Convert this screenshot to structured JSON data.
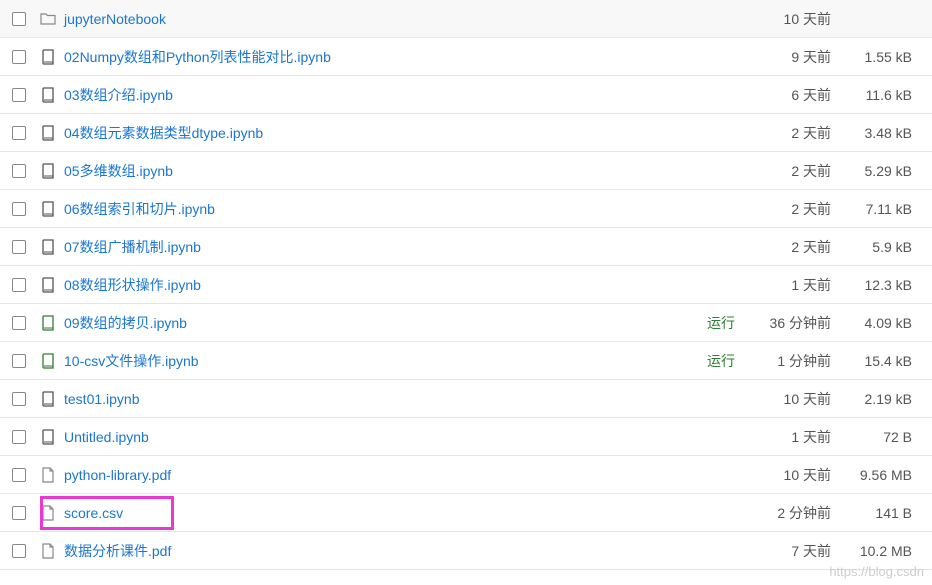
{
  "statusLabel": "运行",
  "watermark": "https://blog.csdn",
  "files": [
    {
      "name": "jupyterNotebook",
      "icon": "folder",
      "running": false,
      "modified": "10 天前",
      "size": "",
      "highlight": false
    },
    {
      "name": "02Numpy数组和Python列表性能对比.ipynb",
      "icon": "notebook",
      "running": false,
      "modified": "9 天前",
      "size": "1.55 kB",
      "highlight": false
    },
    {
      "name": "03数组介绍.ipynb",
      "icon": "notebook",
      "running": false,
      "modified": "6 天前",
      "size": "11.6 kB",
      "highlight": false
    },
    {
      "name": "04数组元素数据类型dtype.ipynb",
      "icon": "notebook",
      "running": false,
      "modified": "2 天前",
      "size": "3.48 kB",
      "highlight": false
    },
    {
      "name": "05多维数组.ipynb",
      "icon": "notebook",
      "running": false,
      "modified": "2 天前",
      "size": "5.29 kB",
      "highlight": false
    },
    {
      "name": "06数组索引和切片.ipynb",
      "icon": "notebook",
      "running": false,
      "modified": "2 天前",
      "size": "7.11 kB",
      "highlight": false
    },
    {
      "name": "07数组广播机制.ipynb",
      "icon": "notebook",
      "running": false,
      "modified": "2 天前",
      "size": "5.9 kB",
      "highlight": false
    },
    {
      "name": "08数组形状操作.ipynb",
      "icon": "notebook",
      "running": false,
      "modified": "1 天前",
      "size": "12.3 kB",
      "highlight": false
    },
    {
      "name": "09数组的拷贝.ipynb",
      "icon": "notebook-running",
      "running": true,
      "modified": "36 分钟前",
      "size": "4.09 kB",
      "highlight": false
    },
    {
      "name": "10-csv文件操作.ipynb",
      "icon": "notebook-running",
      "running": true,
      "modified": "1 分钟前",
      "size": "15.4 kB",
      "highlight": false
    },
    {
      "name": "test01.ipynb",
      "icon": "notebook",
      "running": false,
      "modified": "10 天前",
      "size": "2.19 kB",
      "highlight": false
    },
    {
      "name": "Untitled.ipynb",
      "icon": "notebook",
      "running": false,
      "modified": "1 天前",
      "size": "72 B",
      "highlight": false
    },
    {
      "name": "python-library.pdf",
      "icon": "file",
      "running": false,
      "modified": "10 天前",
      "size": "9.56 MB",
      "highlight": false
    },
    {
      "name": "score.csv",
      "icon": "file",
      "running": false,
      "modified": "2 分钟前",
      "size": "141 B",
      "highlight": true
    },
    {
      "name": "数据分析课件.pdf",
      "icon": "file",
      "running": false,
      "modified": "7 天前",
      "size": "10.2 MB",
      "highlight": false
    }
  ]
}
